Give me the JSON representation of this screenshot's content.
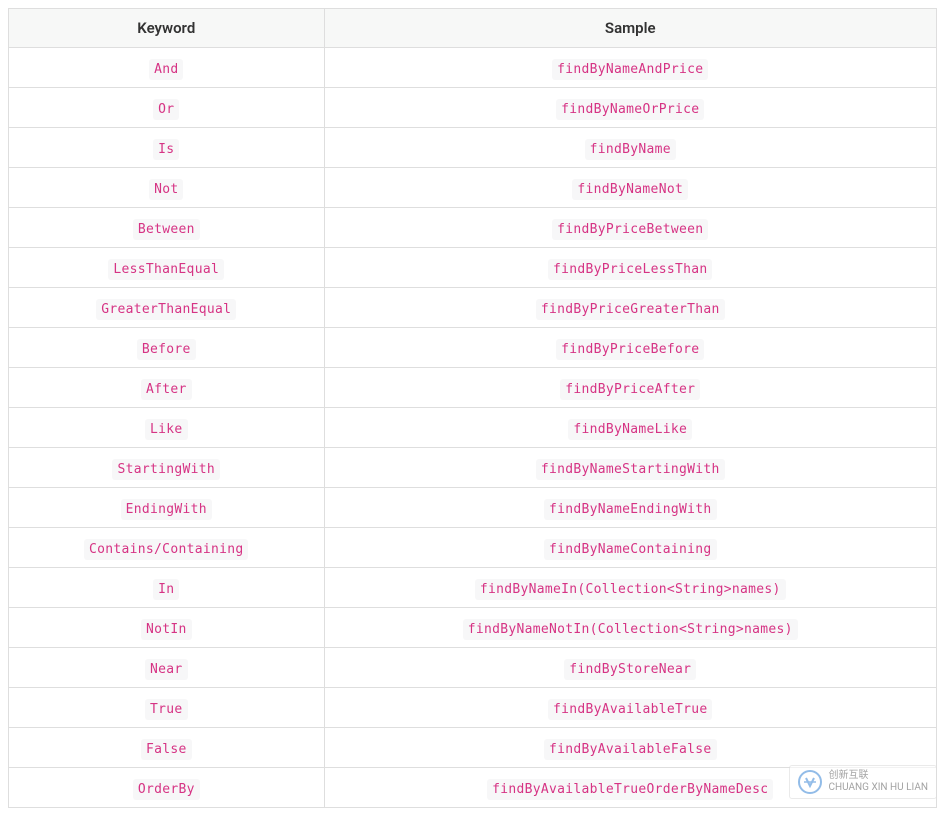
{
  "table": {
    "headers": {
      "keyword": "Keyword",
      "sample": "Sample"
    },
    "rows": [
      {
        "keyword": "And",
        "sample": "findByNameAndPrice"
      },
      {
        "keyword": "Or",
        "sample": "findByNameOrPrice"
      },
      {
        "keyword": "Is",
        "sample": "findByName"
      },
      {
        "keyword": "Not",
        "sample": "findByNameNot"
      },
      {
        "keyword": "Between",
        "sample": "findByPriceBetween"
      },
      {
        "keyword": "LessThanEqual",
        "sample": "findByPriceLessThan"
      },
      {
        "keyword": "GreaterThanEqual",
        "sample": "findByPriceGreaterThan"
      },
      {
        "keyword": "Before",
        "sample": "findByPriceBefore"
      },
      {
        "keyword": "After",
        "sample": "findByPriceAfter"
      },
      {
        "keyword": "Like",
        "sample": "findByNameLike"
      },
      {
        "keyword": "StartingWith",
        "sample": "findByNameStartingWith"
      },
      {
        "keyword": "EndingWith",
        "sample": "findByNameEndingWith"
      },
      {
        "keyword": "Contains/Containing",
        "sample": "findByNameContaining"
      },
      {
        "keyword": "In",
        "sample": "findByNameIn(Collection<String>names)"
      },
      {
        "keyword": "NotIn",
        "sample": "findByNameNotIn(Collection<String>names)"
      },
      {
        "keyword": "Near",
        "sample": "findByStoreNear"
      },
      {
        "keyword": "True",
        "sample": "findByAvailableTrue"
      },
      {
        "keyword": "False",
        "sample": "findByAvailableFalse"
      },
      {
        "keyword": "OrderBy",
        "sample": "findByAvailableTrueOrderByNameDesc"
      }
    ]
  },
  "watermark": {
    "line1": "创新互联",
    "line2": "CHUANG XIN HU LIAN"
  }
}
